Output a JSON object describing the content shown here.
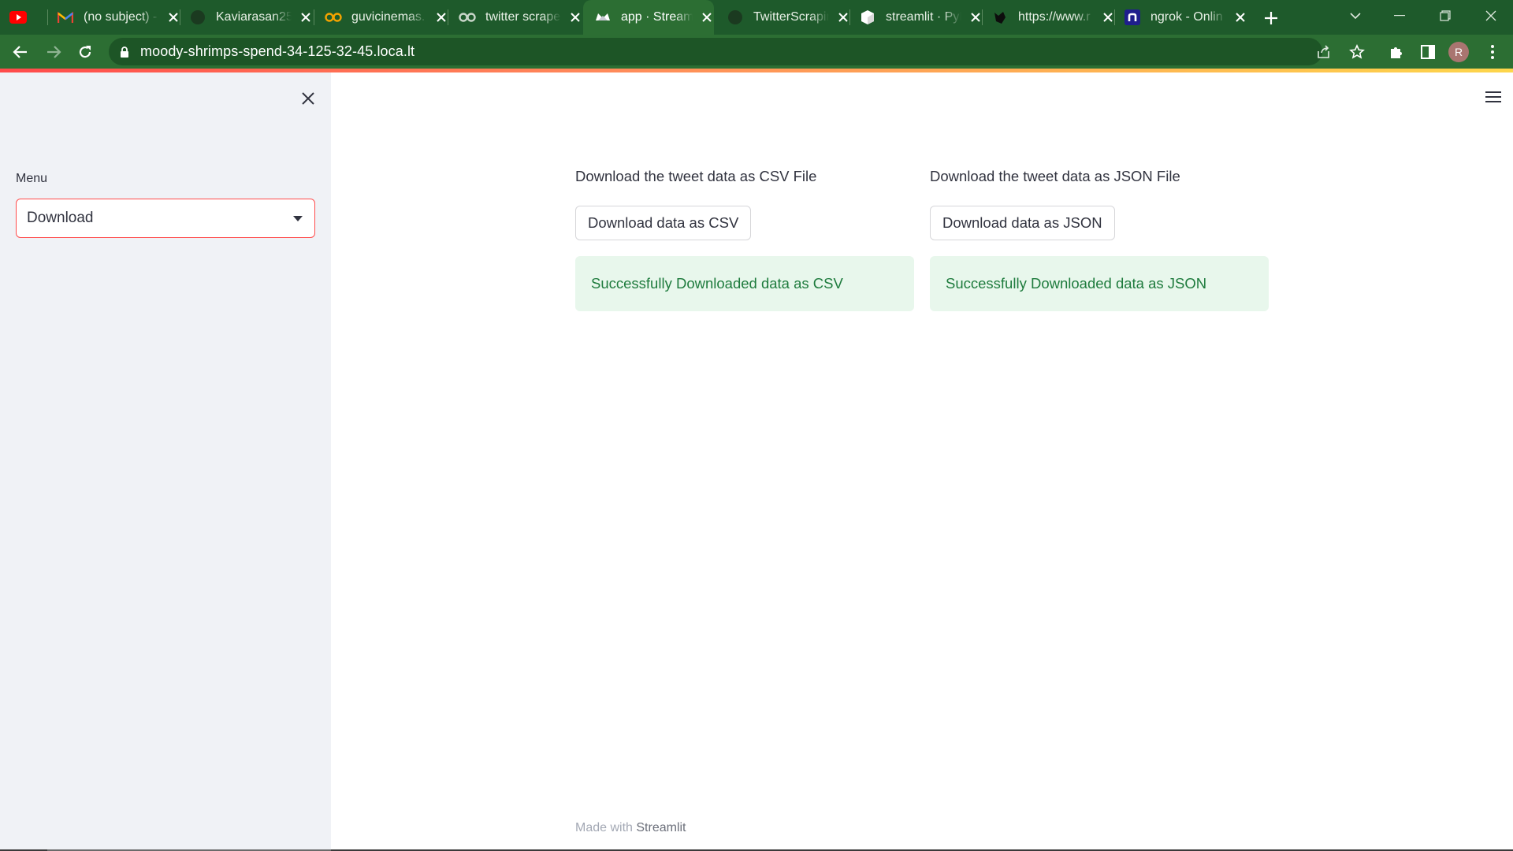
{
  "browser": {
    "tabs": [
      {
        "title": "",
        "icon": "youtube-icon"
      },
      {
        "title": "(no subject) -",
        "icon": "gmail-icon"
      },
      {
        "title": "Kaviarasan25",
        "icon": "github-icon"
      },
      {
        "title": "guvicinemas.",
        "icon": "infinity-icon"
      },
      {
        "title": "twitter scrape",
        "icon": "infinity-icon"
      },
      {
        "title": "app · Streaml",
        "icon": "streamlit-icon",
        "active": true
      },
      {
        "title": "TwitterScrapin",
        "icon": "github-icon"
      },
      {
        "title": "streamlit · PyP",
        "icon": "pypi-cube-icon"
      },
      {
        "title": "https://www.r",
        "icon": "cat-icon"
      },
      {
        "title": "ngrok - Onlin",
        "icon": "ngrok-icon"
      }
    ],
    "url": "moody-shrimps-spend-34-125-32-45.loca.lt",
    "profile_initial": "R"
  },
  "sidebar": {
    "menu_label": "Menu",
    "select_value": "Download"
  },
  "main": {
    "csv": {
      "heading": "Download the tweet data as CSV File",
      "button_label": "Download data as CSV",
      "success_message": "Successfully Downloaded data as CSV"
    },
    "json": {
      "heading": "Download the tweet data as JSON File",
      "button_label": "Download data as JSON",
      "success_message": "Successfully Downloaded data as JSON"
    }
  },
  "footer": {
    "prefix": "Made with ",
    "brand": "Streamlit"
  },
  "colors": {
    "chrome_tabstrip": "#1e5a2b",
    "chrome_toolbar": "#2c6e33",
    "accent": "#ff4b4b",
    "success_bg": "#e8f7ec",
    "success_text": "#1e7b3d",
    "sidebar_bg": "#f0f2f6"
  }
}
